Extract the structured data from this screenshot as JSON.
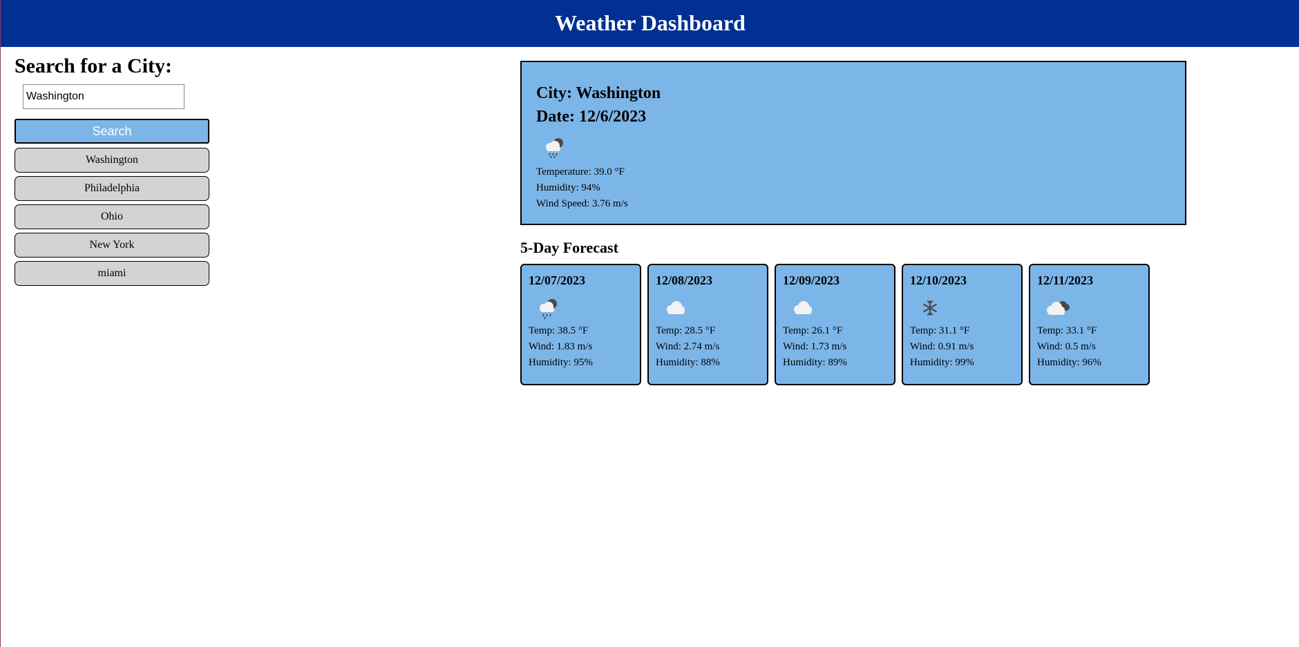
{
  "header": {
    "title": "Weather Dashboard"
  },
  "sidebar": {
    "search_title": "Search for a City:",
    "search_value": "Washington",
    "search_button": "Search",
    "history": [
      "Washington",
      "Philadelphia",
      "Ohio",
      "New York",
      "miami"
    ]
  },
  "current": {
    "city": "City: Washington",
    "date": "Date: 12/6/2023",
    "icon": "rain-cloud-night-icon",
    "temperature": "Temperature: 39.0 °F",
    "humidity": "Humidity: 94%",
    "wind": "Wind Speed: 3.76 m/s"
  },
  "forecast": {
    "title": "5-Day Forecast",
    "days": [
      {
        "date": "12/07/2023",
        "icon": "rain-cloud-night-icon",
        "temp": "Temp: 38.5 °F",
        "wind": "Wind: 1.83 m/s",
        "humidity": "Humidity: 95%"
      },
      {
        "date": "12/08/2023",
        "icon": "cloud-icon",
        "temp": "Temp: 28.5 °F",
        "wind": "Wind: 2.74 m/s",
        "humidity": "Humidity: 88%"
      },
      {
        "date": "12/09/2023",
        "icon": "cloud-icon",
        "temp": "Temp: 26.1 °F",
        "wind": "Wind: 1.73 m/s",
        "humidity": "Humidity: 89%"
      },
      {
        "date": "12/10/2023",
        "icon": "snowflake-icon",
        "temp": "Temp: 31.1 °F",
        "wind": "Wind: 0.91 m/s",
        "humidity": "Humidity: 99%"
      },
      {
        "date": "12/11/2023",
        "icon": "broken-clouds-icon",
        "temp": "Temp: 33.1 °F",
        "wind": "Wind: 0.5 m/s",
        "humidity": "Humidity: 96%"
      }
    ]
  }
}
